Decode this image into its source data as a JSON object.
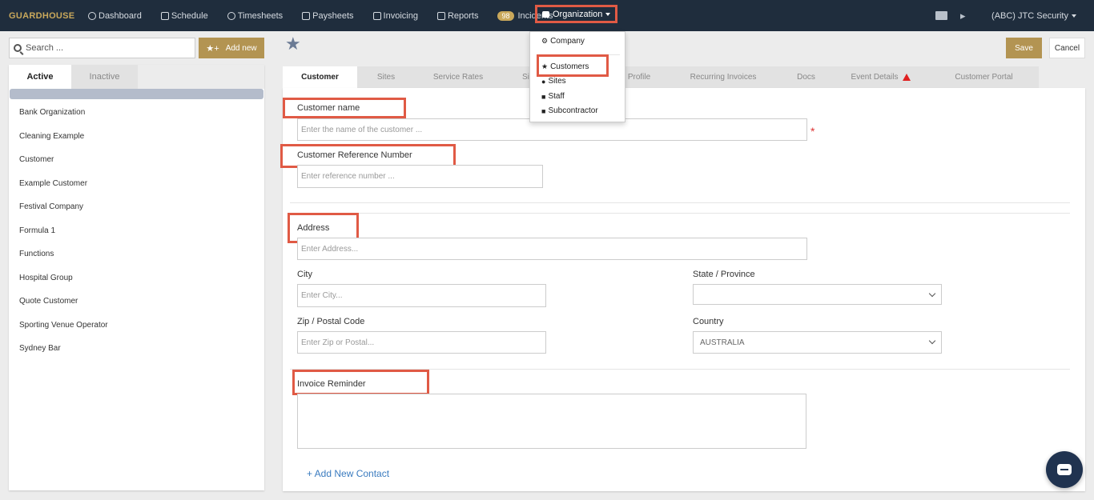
{
  "topnav": {
    "logo": "GUARDHOUSE",
    "items": [
      {
        "label": "Dashboard",
        "icon": "dashboard-icon"
      },
      {
        "label": "Schedule",
        "icon": "calendar-icon"
      },
      {
        "label": "Timesheets",
        "icon": "clock-icon"
      },
      {
        "label": "Paysheets",
        "icon": "money-icon"
      },
      {
        "label": "Invoicing",
        "icon": "invoice-icon"
      },
      {
        "label": "Reports",
        "icon": "table-icon"
      }
    ],
    "incidents_badge": "98",
    "incidents_label": "Incidents",
    "organization_label": "Organization",
    "account_label": "(ABC) JTC Security"
  },
  "org_menu": {
    "items": [
      "Company",
      "Customers",
      "Sites",
      "Staff",
      "Subcontractor"
    ]
  },
  "left": {
    "search_placeholder": "Search ...",
    "add_new_label": "Add new",
    "tabs": [
      "Active",
      "Inactive"
    ],
    "customers": [
      "Bank Organization",
      "Cleaning Example",
      "Customer",
      "Example Customer",
      "Festival Company",
      "Formula 1",
      "Functions",
      "Hospital Group",
      "Quote Customer",
      "Sporting Venue Operator",
      "Sydney Bar"
    ]
  },
  "actions": {
    "save": "Save",
    "cancel": "Cancel"
  },
  "tabs": [
    "Customer",
    "Sites",
    "Service Rates",
    "Si",
    "Profile",
    "Recurring Invoices",
    "Docs",
    "Event Details",
    "Customer Portal"
  ],
  "form": {
    "customer_name_label": "Customer name",
    "customer_name_placeholder": "Enter the name of the customer ...",
    "required_mark": "*",
    "ref_label": "Customer Reference Number",
    "ref_placeholder": "Enter reference number ...",
    "address_label": "Address",
    "address_placeholder": "Enter Address...",
    "city_label": "City",
    "city_placeholder": "Enter City...",
    "state_label": "State / Province",
    "state_value": "",
    "zip_label": "Zip / Postal Code",
    "zip_placeholder": "Enter Zip or Postal...",
    "country_label": "Country",
    "country_value": "AUSTRALIA",
    "invoice_reminder_label": "Invoice Reminder",
    "add_contact_label": "+ Add New Contact"
  },
  "colors": {
    "nav_bg": "#1f2d3d",
    "gold": "#b39452",
    "highlight": "#e05a45"
  }
}
